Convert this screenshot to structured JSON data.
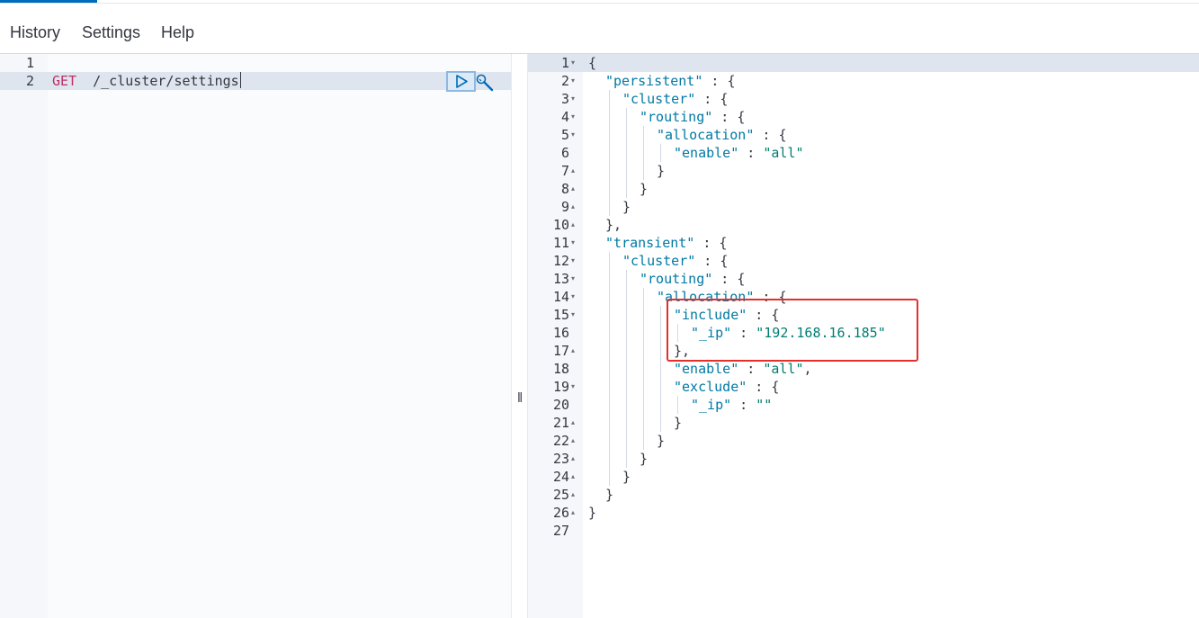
{
  "menu": {
    "items": [
      {
        "label": "History"
      },
      {
        "label": "Settings"
      },
      {
        "label": "Help"
      }
    ]
  },
  "request_editor": {
    "line_numbers": [
      "1",
      "2"
    ],
    "method": "GET",
    "path": "/_cluster/settings",
    "play_icon": "play-icon",
    "wrench_icon": "wrench-icon"
  },
  "splitter": {
    "handle": "‖"
  },
  "response_editor": {
    "lines": [
      {
        "n": "1",
        "fold": "▾",
        "indent": 0,
        "tokens": [
          [
            "punc",
            "{"
          ]
        ]
      },
      {
        "n": "2",
        "fold": "▾",
        "indent": 1,
        "tokens": [
          [
            "key",
            "\"persistent\""
          ],
          [
            "punc",
            " : {"
          ]
        ]
      },
      {
        "n": "3",
        "fold": "▾",
        "indent": 2,
        "tokens": [
          [
            "key",
            "\"cluster\""
          ],
          [
            "punc",
            " : {"
          ]
        ]
      },
      {
        "n": "4",
        "fold": "▾",
        "indent": 3,
        "tokens": [
          [
            "key",
            "\"routing\""
          ],
          [
            "punc",
            " : {"
          ]
        ]
      },
      {
        "n": "5",
        "fold": "▾",
        "indent": 4,
        "tokens": [
          [
            "key",
            "\"allocation\""
          ],
          [
            "punc",
            " : {"
          ]
        ]
      },
      {
        "n": "6",
        "fold": "",
        "indent": 5,
        "tokens": [
          [
            "key",
            "\"enable\""
          ],
          [
            "punc",
            " : "
          ],
          [
            "str",
            "\"all\""
          ]
        ]
      },
      {
        "n": "7",
        "fold": "▴",
        "indent": 4,
        "tokens": [
          [
            "punc",
            "}"
          ]
        ]
      },
      {
        "n": "8",
        "fold": "▴",
        "indent": 3,
        "tokens": [
          [
            "punc",
            "}"
          ]
        ]
      },
      {
        "n": "9",
        "fold": "▴",
        "indent": 2,
        "tokens": [
          [
            "punc",
            "}"
          ]
        ]
      },
      {
        "n": "10",
        "fold": "▴",
        "indent": 1,
        "tokens": [
          [
            "punc",
            "},"
          ]
        ]
      },
      {
        "n": "11",
        "fold": "▾",
        "indent": 1,
        "tokens": [
          [
            "key",
            "\"transient\""
          ],
          [
            "punc",
            " : {"
          ]
        ]
      },
      {
        "n": "12",
        "fold": "▾",
        "indent": 2,
        "tokens": [
          [
            "key",
            "\"cluster\""
          ],
          [
            "punc",
            " : {"
          ]
        ]
      },
      {
        "n": "13",
        "fold": "▾",
        "indent": 3,
        "tokens": [
          [
            "key",
            "\"routing\""
          ],
          [
            "punc",
            " : {"
          ]
        ]
      },
      {
        "n": "14",
        "fold": "▾",
        "indent": 4,
        "tokens": [
          [
            "key",
            "\"allocation\""
          ],
          [
            "punc",
            " : {"
          ]
        ]
      },
      {
        "n": "15",
        "fold": "▾",
        "indent": 5,
        "tokens": [
          [
            "key",
            "\"include\""
          ],
          [
            "punc",
            " : {"
          ]
        ]
      },
      {
        "n": "16",
        "fold": "",
        "indent": 6,
        "tokens": [
          [
            "key",
            "\"_ip\""
          ],
          [
            "punc",
            " : "
          ],
          [
            "str",
            "\"192.168.16.185\""
          ]
        ]
      },
      {
        "n": "17",
        "fold": "▴",
        "indent": 5,
        "tokens": [
          [
            "punc",
            "},"
          ]
        ]
      },
      {
        "n": "18",
        "fold": "",
        "indent": 5,
        "tokens": [
          [
            "key",
            "\"enable\""
          ],
          [
            "punc",
            " : "
          ],
          [
            "str",
            "\"all\""
          ],
          [
            "punc",
            ","
          ]
        ]
      },
      {
        "n": "19",
        "fold": "▾",
        "indent": 5,
        "tokens": [
          [
            "key",
            "\"exclude\""
          ],
          [
            "punc",
            " : {"
          ]
        ]
      },
      {
        "n": "20",
        "fold": "",
        "indent": 6,
        "tokens": [
          [
            "key",
            "\"_ip\""
          ],
          [
            "punc",
            " : "
          ],
          [
            "str",
            "\"\""
          ]
        ]
      },
      {
        "n": "21",
        "fold": "▴",
        "indent": 5,
        "tokens": [
          [
            "punc",
            "}"
          ]
        ]
      },
      {
        "n": "22",
        "fold": "▴",
        "indent": 4,
        "tokens": [
          [
            "punc",
            "}"
          ]
        ]
      },
      {
        "n": "23",
        "fold": "▴",
        "indent": 3,
        "tokens": [
          [
            "punc",
            "}"
          ]
        ]
      },
      {
        "n": "24",
        "fold": "▴",
        "indent": 2,
        "tokens": [
          [
            "punc",
            "}"
          ]
        ]
      },
      {
        "n": "25",
        "fold": "▴",
        "indent": 1,
        "tokens": [
          [
            "punc",
            "}"
          ]
        ]
      },
      {
        "n": "26",
        "fold": "▴",
        "indent": 0,
        "tokens": [
          [
            "punc",
            "}"
          ]
        ]
      },
      {
        "n": "27",
        "fold": "",
        "indent": 0,
        "tokens": []
      }
    ]
  },
  "colors": {
    "accent": "#006bb8",
    "method": "#bd2e68",
    "json_key": "#0079a5",
    "json_string": "#017d73",
    "highlight_box": "#e3302a"
  }
}
